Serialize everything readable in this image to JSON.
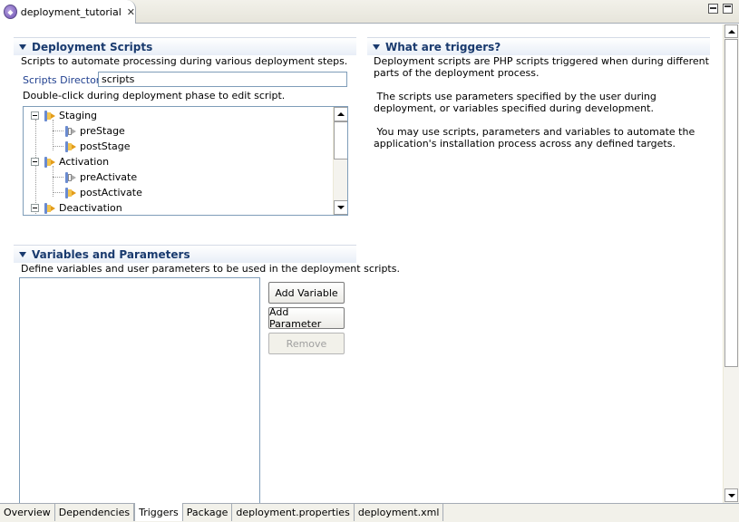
{
  "editor": {
    "tab_title": "deployment_tutorial",
    "file_icon": "php-deployment-icon",
    "close_glyph": "✕"
  },
  "scripts_section": {
    "title": "Deployment Scripts",
    "description": "Scripts to automate processing during various deployment steps.",
    "directory_label": "Scripts Directory",
    "directory_value": "scripts",
    "instruction": "Double-click during deployment phase to edit script.",
    "tree": [
      {
        "label": "Staging",
        "level": 0,
        "type": "phase"
      },
      {
        "label": "preStage",
        "level": 1,
        "type": "script-empty"
      },
      {
        "label": "postStage",
        "level": 1,
        "type": "script"
      },
      {
        "label": "Activation",
        "level": 0,
        "type": "phase"
      },
      {
        "label": "preActivate",
        "level": 1,
        "type": "script-empty"
      },
      {
        "label": "postActivate",
        "level": 1,
        "type": "script"
      },
      {
        "label": "Deactivation",
        "level": 0,
        "type": "phase"
      }
    ]
  },
  "triggers_section": {
    "title": "What are triggers?",
    "paragraphs": [
      "Deployment scripts are PHP scripts triggered when during different parts of the deployment process.",
      " The scripts use parameters specified by the user during deployment, or variables specified during development.",
      " You may use scripts, parameters and variables to automate the application's installation process across any defined targets."
    ]
  },
  "variables_section": {
    "title": "Variables and Parameters",
    "description": "Define variables and user parameters to be used in the deployment scripts.",
    "buttons": {
      "add_variable": "Add Variable",
      "add_parameter": "Add Parameter",
      "remove": "Remove"
    }
  },
  "bottom_tabs": [
    {
      "label": "Overview",
      "active": false
    },
    {
      "label": "Dependencies",
      "active": false
    },
    {
      "label": "Triggers",
      "active": true
    },
    {
      "label": "Package",
      "active": false
    },
    {
      "label": "deployment.properties",
      "active": false
    },
    {
      "label": "deployment.xml",
      "active": false
    }
  ]
}
